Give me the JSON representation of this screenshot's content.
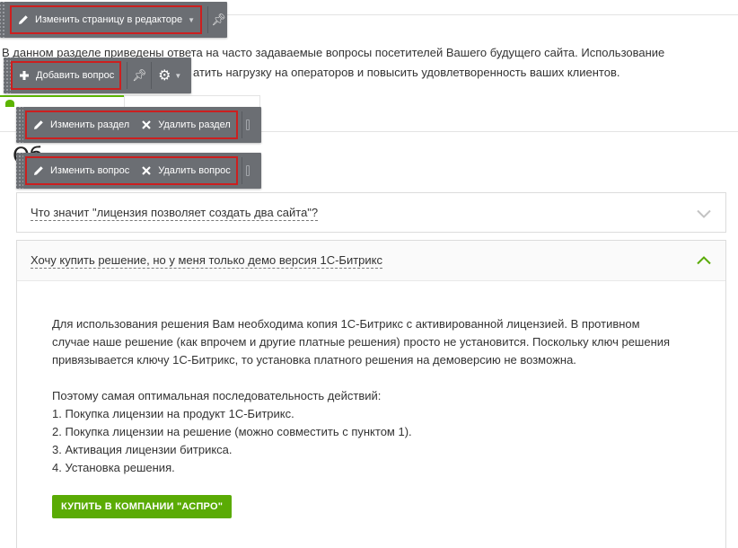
{
  "intro": {
    "line1": "В данном разделе приведены ответа на часто задаваемые вопросы посетителей Вашего будущего сайта. Использование",
    "line2": "атить нагрузку на операторов и повысить удовлетворенность ваших клиентов."
  },
  "heading_fragment": "Об",
  "toolbar_page": {
    "edit_label": "Изменить страницу в редакторе",
    "icons": [
      "pencil-icon",
      "chevron-down-icon",
      "pin-icon"
    ]
  },
  "toolbar_question_add": {
    "add_label": "Добавить вопрос",
    "icons": [
      "plus-icon",
      "pin-icon",
      "gear-icon",
      "chevron-down-icon"
    ]
  },
  "toolbar_section": {
    "edit_label": "Изменить раздел",
    "delete_label": "Удалить раздел",
    "icons": [
      "pencil-icon",
      "close-icon"
    ]
  },
  "toolbar_question": {
    "edit_label": "Изменить вопрос",
    "delete_label": "Удалить вопрос",
    "icons": [
      "pencil-icon",
      "close-icon"
    ]
  },
  "faq": [
    {
      "question": "Что значит \"лицензия позволяет создать два сайта\"?",
      "state": "collapsed"
    },
    {
      "question": "Хочу купить решение, но у меня только демо версия 1С-Битрикс",
      "state": "expanded",
      "answer": {
        "p1": "Для использования решения Вам необходима копия 1С-Битрикс с активированной лицензией. В противном случае наше решение (как впрочем и другие платные решения) просто не установится. Поскольку ключ решения привязывается ключу 1С-Битрикс, то установка платного решения на демоверсию не возможна.",
        "intro": "Поэтому самая оптимальная последовательность действий:",
        "steps": [
          "1. Покупка лицензии на продукт 1С-Битрикс.",
          "2. Покупка лицензии на решение (можно совместить с пунктом 1).",
          "3. Активация лицензии битрикса.",
          "4. Установка решения."
        ],
        "button_label": "КУПИТЬ В КОМПАНИИ \"АСПРО\""
      }
    }
  ],
  "colors": {
    "accent_green": "#5aab05",
    "toolbar_gray": "#6b6e73",
    "highlight_red": "#cc1f1f"
  }
}
